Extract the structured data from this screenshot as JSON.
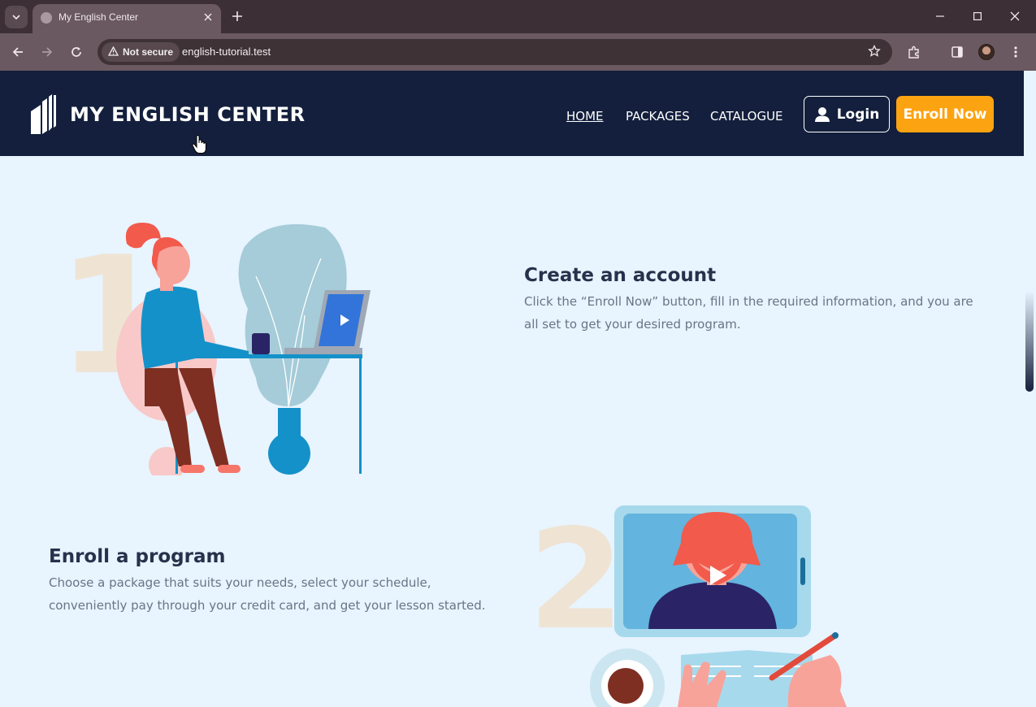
{
  "browser": {
    "tab_title": "My English Center",
    "security_label": "Not secure",
    "url": "english-tutorial.test"
  },
  "site": {
    "logo_text": "MY ENGLISH CENTER",
    "nav": [
      {
        "label": "HOME",
        "active": true
      },
      {
        "label": "PACKAGES",
        "active": false
      },
      {
        "label": "CATALOGUE",
        "active": false
      }
    ],
    "login_label": "Login",
    "enroll_label": "Enroll Now"
  },
  "steps": [
    {
      "number": "1",
      "title": "Create an account",
      "description": "Click the “Enroll Now” button, fill in the required information, and you are all set to get your desired program."
    },
    {
      "number": "2",
      "title": "Enroll a program",
      "description": "Choose a package that suits your needs, select your schedule, conveniently pay through your credit card, and get your lesson started."
    }
  ],
  "colors": {
    "header_bg": "#131f3c",
    "page_bg": "#e8f4fe",
    "accent": "#fca311"
  }
}
